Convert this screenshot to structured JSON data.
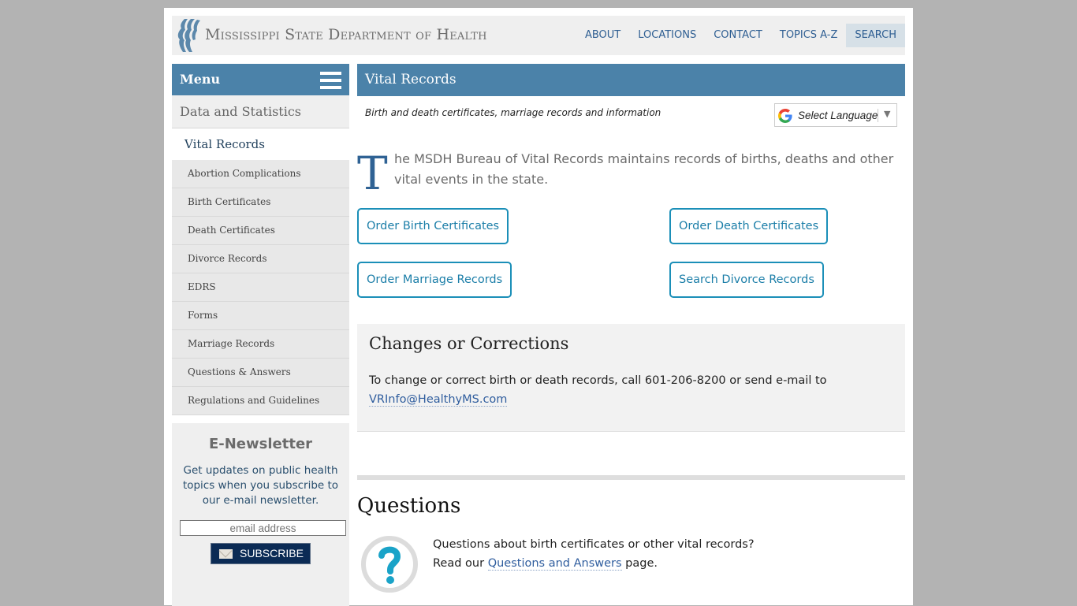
{
  "header": {
    "site_title": "Mississippi State Department of Health",
    "nav": [
      {
        "label": "ABOUT"
      },
      {
        "label": "LOCATIONS"
      },
      {
        "label": "CONTACT"
      },
      {
        "label": "TOPICS A-Z"
      },
      {
        "label": "SEARCH"
      }
    ]
  },
  "sidebar": {
    "menu_label": "Menu",
    "section": "Data and Statistics",
    "current": "Vital Records",
    "items": [
      {
        "label": "Abortion Complications"
      },
      {
        "label": "Birth Certificates"
      },
      {
        "label": "Death Certificates"
      },
      {
        "label": "Divorce Records"
      },
      {
        "label": "EDRS"
      },
      {
        "label": "Forms"
      },
      {
        "label": "Marriage Records"
      },
      {
        "label": "Questions & Answers"
      },
      {
        "label": "Regulations and Guidelines"
      }
    ],
    "newsletter": {
      "title": "E-Newsletter",
      "text": "Get updates on public health topics when you subscribe to our e-mail newsletter.",
      "email_placeholder": "email address",
      "subscribe_label": "SUBSCRIBE"
    }
  },
  "main": {
    "title": "Vital Records",
    "subtitle": "Birth and death certificates, marriage records and information",
    "language_select": "Select Language",
    "intro_dropcap": "T",
    "intro_text": "he MSDH Bureau of Vital Records maintains records of births, deaths and other vital events in the state.",
    "buttons": [
      {
        "label": "Order Birth Certificates"
      },
      {
        "label": "Order Death Certificates"
      },
      {
        "label": "Order Marriage Records"
      },
      {
        "label": "Search Divorce Records"
      }
    ],
    "changes": {
      "title": "Changes or Corrections",
      "text": "To change or correct birth or death records, call 601-206-8200 or send e-mail to",
      "email_link": "VRInfo@HealthyMS.com"
    },
    "questions": {
      "title": "Questions",
      "line1": "Questions about birth certificates or other vital records?",
      "line2_prefix": "Read our ",
      "link": "Questions and Answers",
      "line2_suffix": " page."
    }
  },
  "colors": {
    "brand_blue": "#4b82a9",
    "button_border": "#1b8fb8",
    "link": "#2f5d9e",
    "subscribe_bg": "#0b2b55"
  }
}
